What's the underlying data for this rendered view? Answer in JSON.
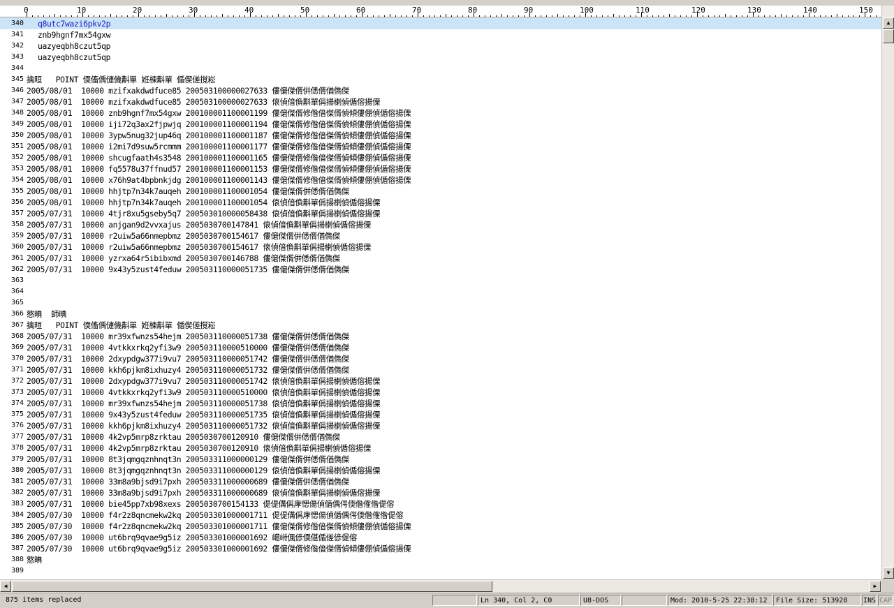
{
  "ruler": {
    "labels": [
      "0",
      "10",
      "20",
      "30",
      "40",
      "50",
      "60",
      "70",
      "80",
      "90",
      "100",
      "110",
      "120",
      "130",
      "140",
      "150"
    ]
  },
  "lines": [
    {
      "n": "340",
      "t": "q8utc7wazi6pkv2p",
      "current": true,
      "indent": 2
    },
    {
      "n": "341",
      "t": "znb9hgnf7mx54gxw",
      "indent": 2
    },
    {
      "n": "342",
      "t": "uazyeqbh8czut5qp",
      "indent": 2
    },
    {
      "n": "343",
      "t": "uazyeqbh8czut5qp",
      "indent": 2
    },
    {
      "n": "344",
      "t": ""
    },
    {
      "n": "345",
      "t": "擒晅   POINT 偄傗偊僆僟斠單 姙棟斠單 偱偰傞撹崧"
    },
    {
      "n": "346",
      "t": "2005/08/01  10000 mzifxakdwdfuce85 200503100000027633 僂僒傑偦倂僁偦偤儁傑"
    },
    {
      "n": "347",
      "t": "2005/08/01  10000 mzifxakdwdfuce85 200503100000027633 偯偵偣偩斠單偁揚楋偵偱傛揚傈"
    },
    {
      "n": "348",
      "t": "2005/08/01  10000 znb9hgnf7mx54gxw 200100001100001199 僂僒傑偦修偺偣傑偦偵傾僂倗偵偱傛揚傈"
    },
    {
      "n": "349",
      "t": "2005/08/01  10000 iji72q3ax2fjpwjq 200100001100001194 僂僒傑偦修偺偣傑偦偵傾僂倗偵偱傛揚傈"
    },
    {
      "n": "350",
      "t": "2005/08/01  10000 3ypw5nug32jup46q 200100001100001187 僂僒傑偦修偺偣傑偦偵傾僂倗偵偱傛揚傈"
    },
    {
      "n": "351",
      "t": "2005/08/01  10000 i2mi7d9suw5rcmmm 200100001100001177 僂僒傑偦修偺偣傑偦偵傾僂倗偵偱傛揚傈"
    },
    {
      "n": "352",
      "t": "2005/08/01  10000 shcugfaath4s3548 200100001100001165 僂僒傑偦修偺偣傑偦偵傾僂倗偵偱傛揚傈"
    },
    {
      "n": "353",
      "t": "2005/08/01  10000 fq5578u37ffnud57 200100001100001153 僂僒傑偦修偺偣傑偦偵傾僂倗偵偱傛揚傈"
    },
    {
      "n": "354",
      "t": "2005/08/01  10000 x76h9at4bpbnkjdg 200100001100001143 僂僒傑偦修偺偣傑偦偵傾僂倗偵偱傛揚傈"
    },
    {
      "n": "355",
      "t": "2005/08/01  10000 hhjtp7n34k7auqeh 200100001100001054 僂僒傑偦倂僁偦偤儁傑"
    },
    {
      "n": "356",
      "t": "2005/08/01  10000 hhjtp7n34k7auqeh 200100001100001054 偯偵偣偩斠單偁揚楋偵偱傛揚傈"
    },
    {
      "n": "357",
      "t": "2005/07/31  10000 4tjr8xu5gseby5q7 200503010000058438 偯偵偣偩斠單偁揚楋偵偱傛揚傈"
    },
    {
      "n": "358",
      "t": "2005/07/31  10000 anjgan9d2vvxajus 2005030700147841 偯偵偣偩斠單偁揚楋偵偱傛揚傈"
    },
    {
      "n": "359",
      "t": "2005/07/31  10000 r2uiw5a66nmepbmz 2005030700154617 僂僒傑偦倂僁偦偤儁傑"
    },
    {
      "n": "360",
      "t": "2005/07/31  10000 r2uiw5a66nmepbmz 2005030700154617 偯偵偣偩斠單偁揚楋偵偱傛揚傈"
    },
    {
      "n": "361",
      "t": "2005/07/31  10000 yzrxa64r5ibibxmd 2005030700146788 僂僒傑偦倂僁偦偤儁傑"
    },
    {
      "n": "362",
      "t": "2005/07/31  10000 9x43y5zust4feduw 200503110000051735 僂僒傑偦倂僁偦偤儁傑"
    },
    {
      "n": "363",
      "t": ""
    },
    {
      "n": "364",
      "t": ""
    },
    {
      "n": "365",
      "t": ""
    },
    {
      "n": "366",
      "t": "憗晪  師晪"
    },
    {
      "n": "367",
      "t": "擒晅   POINT 偄傗偊僆僟斠單 姙棟斠單 偱偰傞撹崧"
    },
    {
      "n": "368",
      "t": "2005/07/31  10000 mr39xfwnzs54hejm 200503110000051738 僂僒傑偦倂僁偦偤儁傑"
    },
    {
      "n": "369",
      "t": "2005/07/31  10000 4vtkkxrkq2yfi3w9 200503110000510000 僂僒傑偦倂僁偦偤儁傑"
    },
    {
      "n": "370",
      "t": "2005/07/31  10000 2dxypdgw377i9vu7 200503110000051742 僂僒傑偦倂僁偦偤儁傑"
    },
    {
      "n": "371",
      "t": "2005/07/31  10000 kkh6pjkm8ixhuzy4 200503110000051732 僂僒傑偦倂僁偦偤儁傑"
    },
    {
      "n": "372",
      "t": "2005/07/31  10000 2dxypdgw377i9vu7 200503110000051742 偯偵偣偩斠單偁揚楋偵偱傛揚傈"
    },
    {
      "n": "373",
      "t": "2005/07/31  10000 4vtkkxrkq2yfi3w9 200503110000510000 偯偵偣偩斠單偁揚楋偵偱傛揚傈"
    },
    {
      "n": "374",
      "t": "2005/07/31  10000 mr39xfwnzs54hejm 200503110000051738 偯偵偣偩斠單偁揚楋偵偱傛揚傈"
    },
    {
      "n": "375",
      "t": "2005/07/31  10000 9x43y5zust4feduw 200503110000051735 偯偵偣偩斠單偁揚楋偵偱傛揚傈"
    },
    {
      "n": "376",
      "t": "2005/07/31  10000 kkh6pjkm8ixhuzy4 200503110000051732 偯偵偣偩斠單偁揚楋偵偱傛揚傈"
    },
    {
      "n": "377",
      "t": "2005/07/31  10000 4k2vp5mrp8zrktau 2005030700120910 僂僒傑偦倂僁偦偤儁傑"
    },
    {
      "n": "378",
      "t": "2005/07/31  10000 4k2vp5mrp8zrktau 2005030700120910 偯偵偣偩斠單偁揚楋偵偱傛揚傈"
    },
    {
      "n": "379",
      "t": "2005/07/31  10000 8t3jqmgqznhnqt3n 200503311000000129 僂僒傑偦倂僁偦偤儁傑"
    },
    {
      "n": "380",
      "t": "2005/07/31  10000 8t3jqmgqznhnqt3n 200503311000000129 偯偵偣偩斠單偁揚楋偵偱傛揚傈"
    },
    {
      "n": "381",
      "t": "2005/07/31  10000 33m8a9bjsd9i7pxh 200503311000000689 僂僒傑偦倂僁偦偤儁傑"
    },
    {
      "n": "382",
      "t": "2005/07/31  10000 33m8a9bjsd9i7pxh 200503311000000689 偯偵偣偩斠單偁揚楋偵偱傛揚傈"
    },
    {
      "n": "383",
      "t": "2005/07/31  10000 bie45pp7xb98xexs 2005030700154133 偍偍傋偁庨愢偒偵偱偊偔偄偺傕偺偍傛"
    },
    {
      "n": "384",
      "t": "2005/07/30  10000 f4r2z8qncmekw2kq 200503301000001711 偍偍傋偁庨愢偒偵偱偊偔偄偺傕偺偍傛"
    },
    {
      "n": "385",
      "t": "2005/07/30  10000 f4r2z8qncmekw2kq 200503301000001711 僂僒傑偦修偺偣傑偦偵傾僂倗偵偱傛揚傈"
    },
    {
      "n": "386",
      "t": "2005/07/30  10000 ut6brq9qvae9g5iz 200503301000001692 嶱崻偑偐偄偡偱傞偐偍傛"
    },
    {
      "n": "387",
      "t": "2005/07/30  10000 ut6brq9qvae9g5iz 200503301000001692 僂僒傑偦修偺偣傑偦偵傾僂倗偵偱傛揚傈"
    },
    {
      "n": "388",
      "t": "憗晪"
    },
    {
      "n": "389",
      "t": ""
    }
  ],
  "status": {
    "message": "875 items replaced",
    "position": "Ln 340, Col 2, C0",
    "encoding": "U8-DOS",
    "modified": "Mod: 2010-5-25 22:38:12",
    "filesize": "File Size: 513928",
    "ins": "INS",
    "cap": "CAP"
  }
}
